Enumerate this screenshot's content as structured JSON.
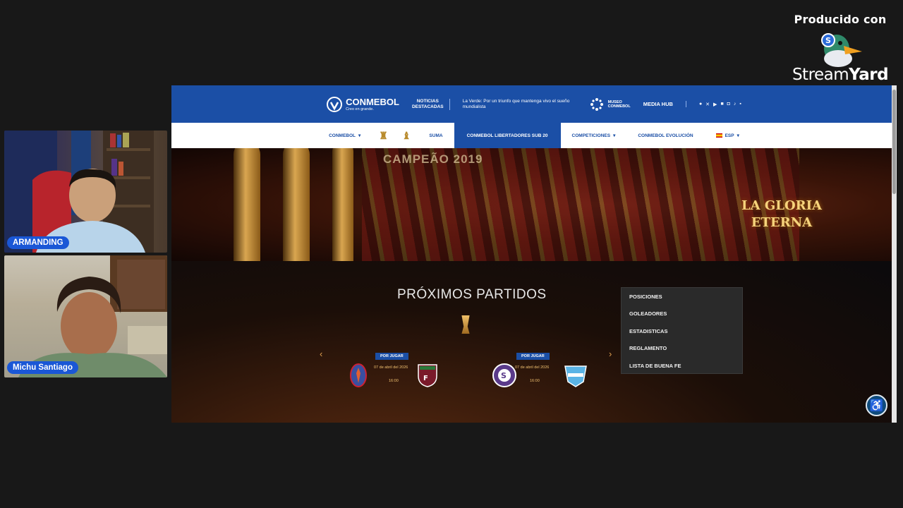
{
  "branding": {
    "produced_with": "Producido con",
    "logo_text_light": "Stream",
    "logo_text_bold": "Yard",
    "logo_icon": "duck-icon"
  },
  "participants": [
    {
      "name": "ARMANDING"
    },
    {
      "name": "Michu Santiago"
    }
  ],
  "site": {
    "topbar": {
      "logo": "CONMEBOL",
      "logo_tagline": "Creo en grande.",
      "noticias_line1": "NOTICIAS",
      "noticias_line2": "DESTACADAS",
      "headline": "La Verde: Por un triunfo que mantenga vivo el sueño mundialista",
      "museo_line1": "MUSEO",
      "museo_line2": "CONMEBOL",
      "media_hub": "MEDIA HUB",
      "social_icons": [
        "facebook-icon",
        "x-icon",
        "youtube-icon",
        "linkedin-icon",
        "instagram-icon",
        "tiktok-icon",
        "twitch-icon"
      ]
    },
    "nav": {
      "conmebol": "CONMEBOL",
      "suma": "SUMA",
      "active": "CONMEBOL LIBERTADORES SUB 20",
      "competiciones": "COMPETICIONES",
      "evolucion": "CONMEBOL EVOLUCIÓN",
      "language": "ESP"
    },
    "hero": {
      "banner": "CAMPEÃO 2019",
      "gloria_line1": "LA GLORIA",
      "gloria_line2": "ETERNA"
    },
    "section_title": "PRÓXIMOS PARTIDOS",
    "matches": [
      {
        "status": "POR JUGAR",
        "date": "07 de abril del 2026",
        "time": "16:00"
      },
      {
        "status": "POR JUGAR",
        "date": "07 de abril del 2026",
        "time": "16:00"
      }
    ],
    "dropdown": [
      "POSICIONES",
      "GOLEADORES",
      "ESTADISTICAS",
      "REGLAMENTO",
      "LISTA DE BUENA FE"
    ]
  },
  "colors": {
    "conmebol_blue": "#1b4fa6",
    "gold": "#f0c070",
    "badge_blue": "#1a57d6"
  }
}
